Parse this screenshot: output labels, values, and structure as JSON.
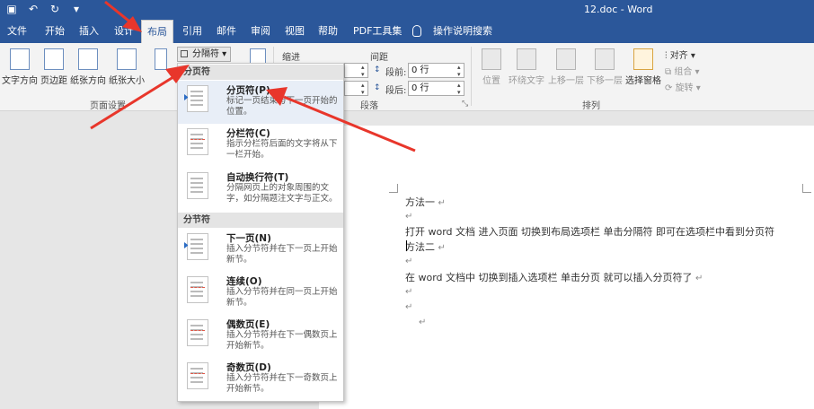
{
  "window": {
    "title": "12.doc - Word"
  },
  "qat": {
    "save_icon": "floppy-icon",
    "undo_icon": "undo-icon",
    "redo_icon": "redo-icon",
    "custom_icon": "dropdown-icon"
  },
  "tabs": [
    {
      "label": "文件"
    },
    {
      "label": "开始"
    },
    {
      "label": "插入"
    },
    {
      "label": "设计"
    },
    {
      "label": "布局",
      "active": true
    },
    {
      "label": "引用"
    },
    {
      "label": "邮件"
    },
    {
      "label": "审阅"
    },
    {
      "label": "视图"
    },
    {
      "label": "帮助"
    },
    {
      "label": "PDF工具集"
    },
    {
      "label": "操作说明搜索"
    }
  ],
  "ribbon": {
    "page_setup": {
      "text_direction": "文字方向",
      "margins": "页边距",
      "orientation": "纸张方向",
      "size": "纸张大小",
      "label": "页面设置",
      "breaks_button": "分隔符"
    },
    "indent_label": "缩进",
    "spacing_label": "间距",
    "before_label": "段前:",
    "before_value": "0 行",
    "after_label": "段后:",
    "after_value": "0 行",
    "paragraph_label": "段落",
    "arrange": {
      "position": "位置",
      "wrap_text": "环绕文字",
      "bring_forward": "上移一层",
      "send_backward": "下移一层",
      "selection_pane": "选择窗格",
      "align": "对齐",
      "group": "组合",
      "rotate": "旋转",
      "label": "排列"
    }
  },
  "breaks_menu": {
    "page_breaks_header": "分页符",
    "section_breaks_header": "分节符",
    "items": [
      {
        "title": "分页符(P)",
        "desc": "标记一页结束与下一页开始的位置。"
      },
      {
        "title": "分栏符(C)",
        "desc": "指示分栏符后面的文字将从下一栏开始。"
      },
      {
        "title": "自动换行符(T)",
        "desc": "分隔网页上的对象周围的文字，如分隔题注文字与正文。"
      },
      {
        "title": "下一页(N)",
        "desc": "插入分节符并在下一页上开始新节。"
      },
      {
        "title": "连续(O)",
        "desc": "插入分节符并在同一页上开始新节。"
      },
      {
        "title": "偶数页(E)",
        "desc": "插入分节符并在下一偶数页上开始新节。"
      },
      {
        "title": "奇数页(D)",
        "desc": "插入分节符并在下一奇数页上开始新节。"
      }
    ]
  },
  "document": {
    "lines": [
      "方法一",
      "",
      "打开 word 文档   进入页面   切换到布局选项栏   单击分隔符   即可在选项栏中看到分页符",
      "方法二",
      "",
      "在 word 文档中   切换到插入选项栏   单击分页   就可以插入分页符了",
      "",
      "",
      ""
    ],
    "paragraph_mark": "↵"
  },
  "colors": {
    "accent": "#2b579a",
    "annotation": "#e8362b"
  }
}
